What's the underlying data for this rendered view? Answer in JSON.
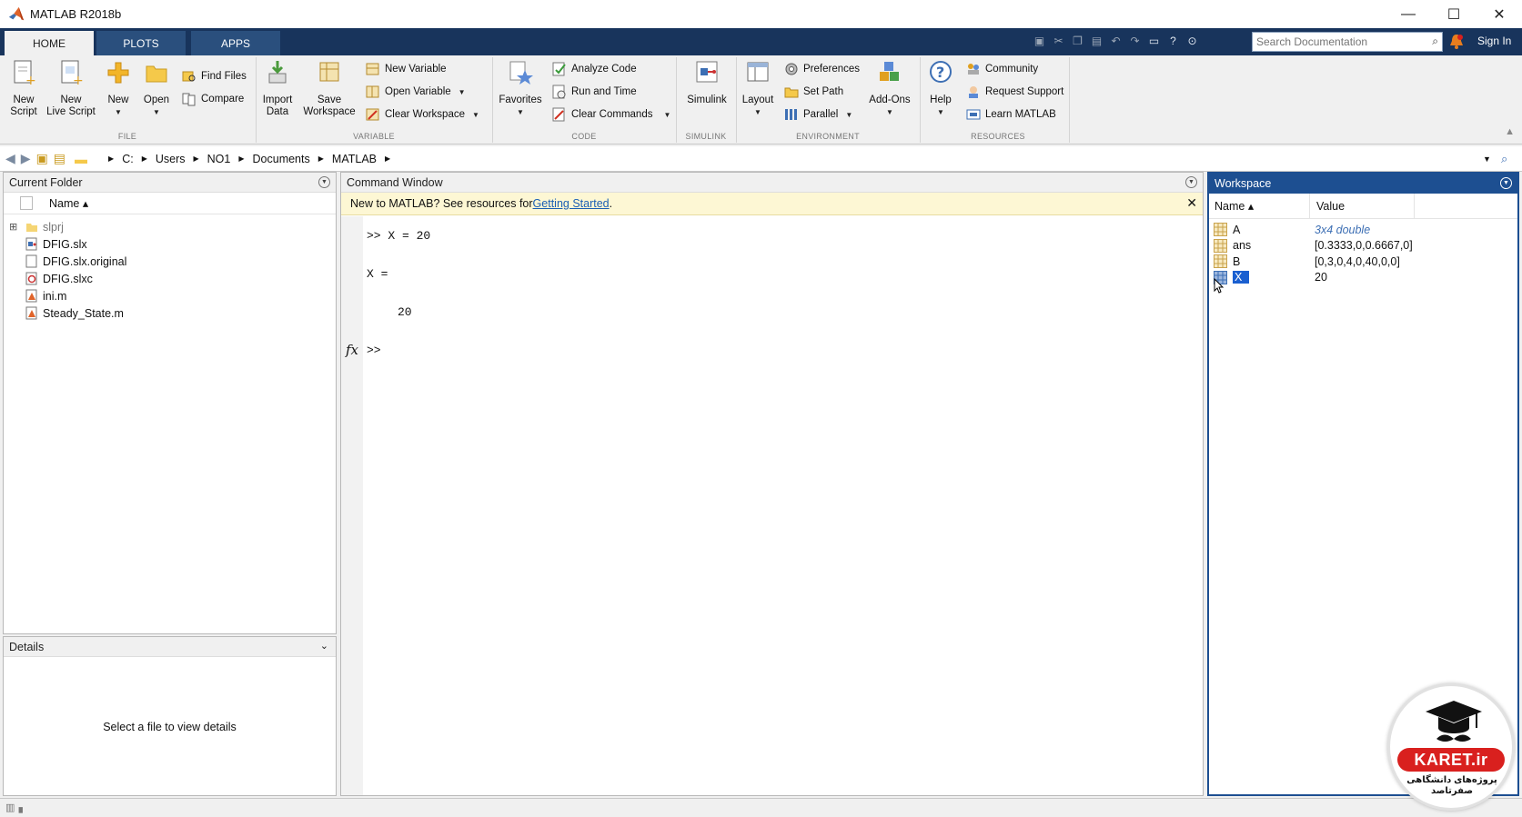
{
  "window": {
    "title": "MATLAB R2018b",
    "minimize": "—",
    "maximize": "☐",
    "close": "✕"
  },
  "tabs": [
    {
      "label": "HOME"
    },
    {
      "label": "PLOTS"
    },
    {
      "label": "APPS"
    }
  ],
  "search": {
    "placeholder": "Search Documentation"
  },
  "signin": "Sign In",
  "ribbon": {
    "file": {
      "group": "FILE",
      "new_script": [
        "New",
        "Script"
      ],
      "new_live_script": [
        "New",
        "Live Script"
      ],
      "new": "New",
      "open": "Open",
      "find_files": "Find Files",
      "compare": "Compare"
    },
    "variable": {
      "group": "VARIABLE",
      "import_data": [
        "Import",
        "Data"
      ],
      "save_workspace": [
        "Save",
        "Workspace"
      ],
      "new_variable": "New Variable",
      "open_variable": "Open Variable",
      "clear_workspace": "Clear Workspace"
    },
    "code": {
      "group": "CODE",
      "favorites": "Favorites",
      "analyze_code": "Analyze Code",
      "run_and_time": "Run and Time",
      "clear_commands": "Clear Commands"
    },
    "simulink": {
      "group": "SIMULINK",
      "simulink": "Simulink"
    },
    "environment": {
      "group": "ENVIRONMENT",
      "layout": "Layout",
      "preferences": "Preferences",
      "set_path": "Set Path",
      "parallel": "Parallel",
      "add_ons": "Add-Ons"
    },
    "resources": {
      "group": "RESOURCES",
      "help": "Help",
      "community": "Community",
      "request_support": "Request Support",
      "learn_matlab": "Learn MATLAB"
    }
  },
  "address": {
    "path": [
      "C:",
      "Users",
      "NO1",
      "Documents",
      "MATLAB"
    ]
  },
  "current_folder": {
    "title": "Current Folder",
    "column": "Name ▴",
    "files": [
      {
        "name": "slprj",
        "type": "folder"
      },
      {
        "name": "DFIG.slx",
        "type": "slx"
      },
      {
        "name": "DFIG.slx.original",
        "type": "doc"
      },
      {
        "name": "DFIG.slxc",
        "type": "slxc"
      },
      {
        "name": "ini.m",
        "type": "m"
      },
      {
        "name": "Steady_State.m",
        "type": "m"
      }
    ]
  },
  "details": {
    "title": "Details",
    "placeholder": "Select a file to view details"
  },
  "command_window": {
    "title": "Command Window",
    "info_text": "New to MATLAB? See resources for ",
    "info_link": "Getting Started",
    "info_end": ".",
    "lines": [
      ">> X = 20",
      "X =",
      "20"
    ],
    "fx": "fx",
    "prompt": ">>"
  },
  "workspace": {
    "title": "Workspace",
    "col_name": "Name ▴",
    "col_value": "Value",
    "vars": [
      {
        "name": "A",
        "value": "3x4 double"
      },
      {
        "name": "ans",
        "value": "[0.3333,0,0.6667,0]"
      },
      {
        "name": "B",
        "value": "[0,3,0,4,0,40,0,0]"
      },
      {
        "name": "X",
        "value": "20"
      }
    ]
  },
  "watermark": {
    "brand": "KARET.ir",
    "tagline": "پروژه‌های دانشگاهی صفرتاصد"
  },
  "colors": {
    "tab_bar": "#18345c",
    "workspace_head": "#1d4f91",
    "selection": "#1a5fd0",
    "info_bg": "#fdf7d4",
    "link": "#1a5fb4",
    "brand_red": "#d9201e"
  }
}
